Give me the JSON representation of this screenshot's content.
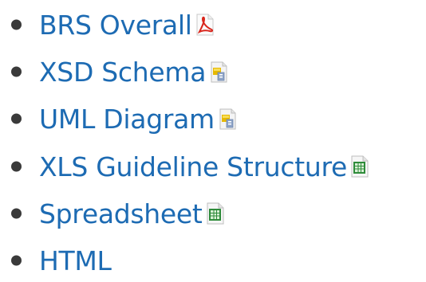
{
  "links": [
    {
      "label": "BRS Overall",
      "icon": "pdf-icon"
    },
    {
      "label": "XSD Schema",
      "icon": "generic-file-icon"
    },
    {
      "label": "UML Diagram",
      "icon": "generic-file-icon"
    },
    {
      "label": "XLS Guideline Structure",
      "icon": "spreadsheet-icon"
    },
    {
      "label": "Spreadsheet",
      "icon": "spreadsheet-icon"
    },
    {
      "label": "HTML",
      "icon": ""
    }
  ],
  "colors": {
    "link": "#1d6bb3",
    "bullet": "#3a3a3a",
    "pdf_red": "#d9261c",
    "generic_yellow": "#e6b800",
    "spreadsheet_green": "#2e8b3a"
  }
}
